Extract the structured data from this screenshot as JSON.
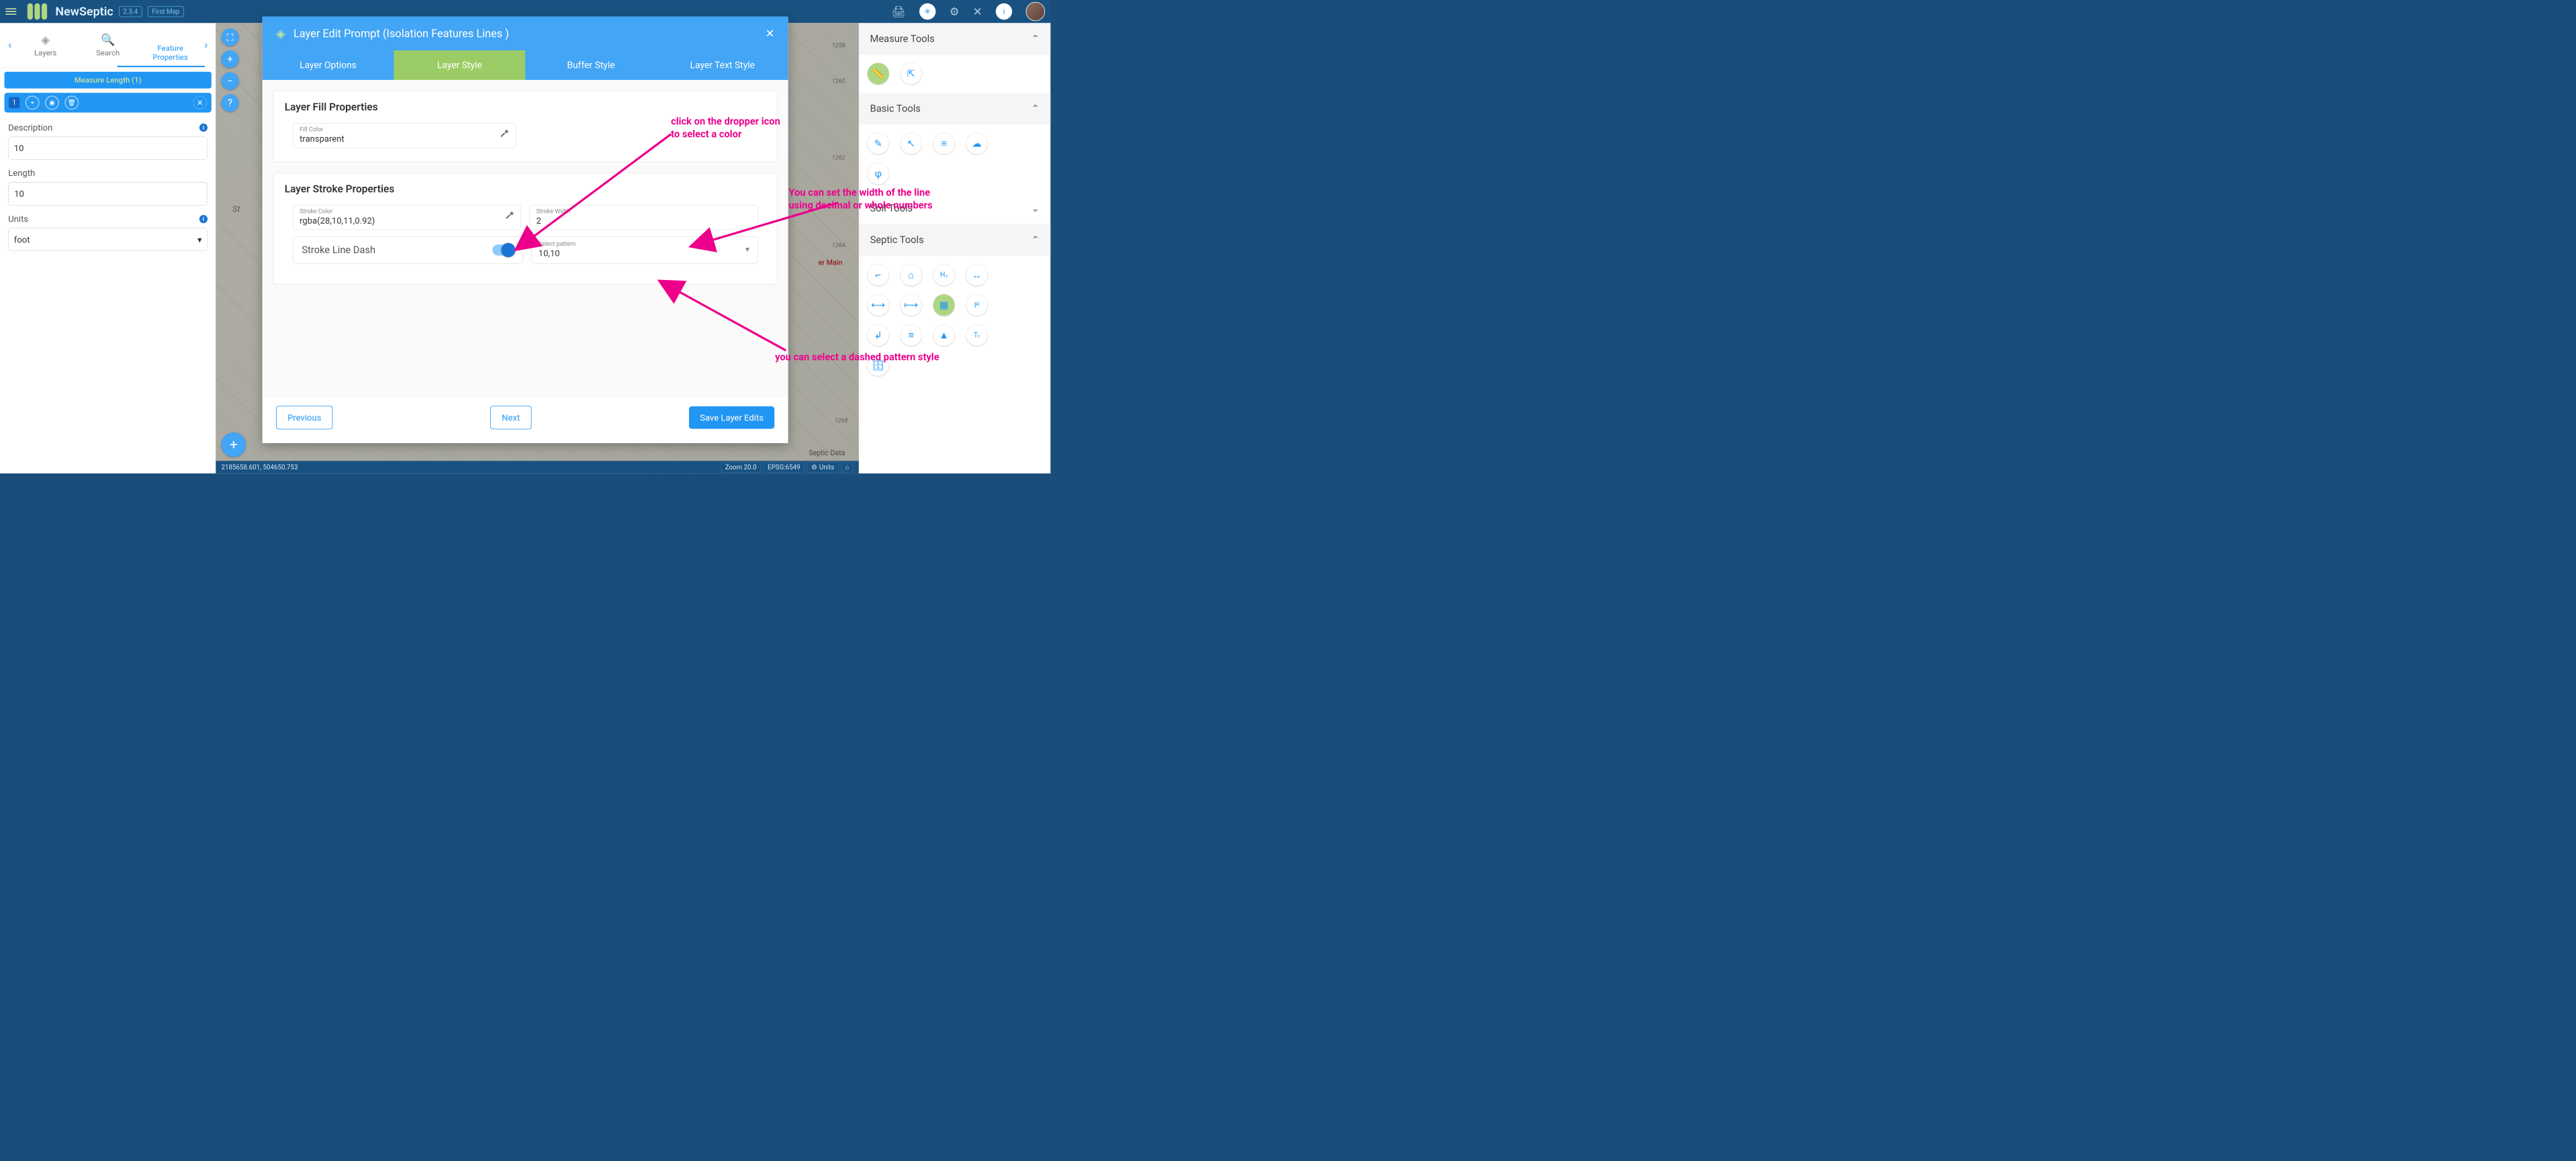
{
  "topbar": {
    "app_title": "NewSeptic",
    "version": "2.3.4",
    "map_name": "First Map"
  },
  "left_panel": {
    "tabs": {
      "layers": "Layers",
      "search": "Search",
      "feature_props": "Feature Properties"
    },
    "measure_chip": "Measure Length (1)",
    "desc_label": "Description",
    "desc_value": "10",
    "length_label": "Length",
    "length_value": "10",
    "units_label": "Units",
    "units_value": "foot",
    "badge_num": "1"
  },
  "map_footer": {
    "coords": "2185658.601, 504650.753",
    "zoom": "Zoom 20.0",
    "epsg": "EPSG:6549",
    "units": "Units"
  },
  "map_labels": {
    "septic": "Septic Data",
    "main": "er Main",
    "e1258": "1258",
    "e1260": "1260",
    "e1262": "1262",
    "e1264": "1264",
    "e1268": "1268",
    "st": "St"
  },
  "right_panel": {
    "measure": "Measure Tools",
    "basic": "Basic Tools",
    "soil": "Soil Tools",
    "septic": "Septic Tools"
  },
  "modal": {
    "title": "Layer Edit Prompt (Isolation Features Lines )",
    "tabs": {
      "options": "Layer Options",
      "style": "Layer Style",
      "buffer": "Buffer Style",
      "text": "Layer Text Style"
    },
    "fill_section": "Layer Fill Properties",
    "fill_color_label": "Fill Color",
    "fill_color_value": "transparent",
    "stroke_section": "Layer Stroke Properties",
    "stroke_color_label": "Stroke Color",
    "stroke_color_value": "rgba(28,10,11,0.92)",
    "stroke_width_label": "Stroke Width",
    "stroke_width_value": "2",
    "dash_label": "Stroke Line Dash",
    "pattern_label": "Select pattern",
    "pattern_value": "10,10",
    "prev_btn": "Previous",
    "next_btn": "Next",
    "save_btn": "Save Layer Edits"
  },
  "annotations": {
    "dropper": "click on the dropper icon\nto select a color",
    "width": "You can set the width of the line\nusing decimal or whole numbers",
    "dash": "you can select a dashed pattern style"
  }
}
